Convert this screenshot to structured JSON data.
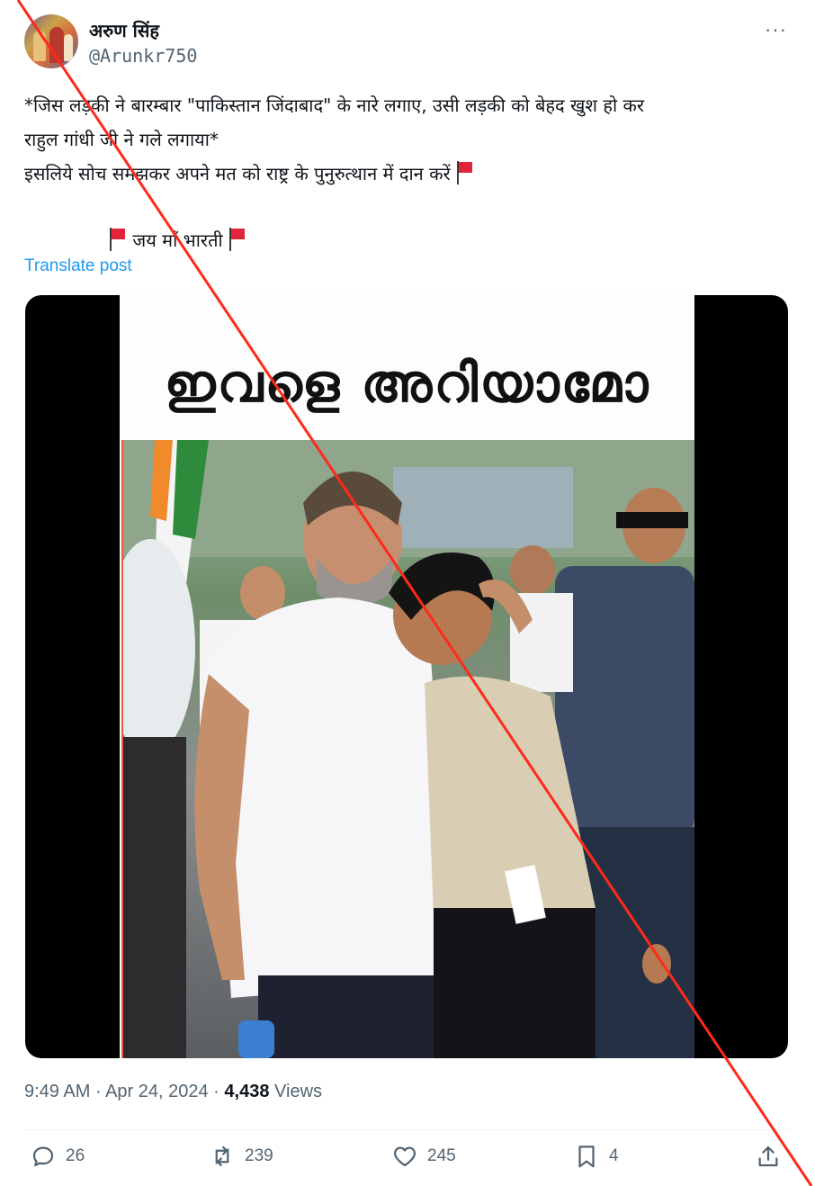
{
  "author": {
    "display_name": "अरुण सिंह",
    "handle": "@Arunkr750",
    "avatar_icon": "profile-photo"
  },
  "more_icon": "ellipsis-icon",
  "more_label": "···",
  "tweet": {
    "lines": [
      "*जिस लड़की ने बारम्बार \"पाकिस्तान जिंदाबाद\" के नारे लगाए, उसी लड़की को बेहद खुश हो कर",
      "राहुल गांधी जी ने गले लगाया*",
      "इसलिये सोच समझकर अपने मत को राष्ट्र के पुनुरुत्थान में दान करें",
      "जय माँ भारती"
    ],
    "flag_icon": "red-flag-emoji",
    "translate_label": "Translate post"
  },
  "media": {
    "title": "ഇവളെ അറിയാമോ",
    "description_icon": "photo"
  },
  "meta": {
    "time": "9:49 AM",
    "separator": "·",
    "date": "Apr 24, 2024",
    "separator2": "·",
    "views_count": "4,438",
    "views_label": "Views"
  },
  "actions": {
    "replies": "26",
    "reposts": "239",
    "likes": "245",
    "bookmarks": "4"
  },
  "colors": {
    "accent": "#1d9bf0",
    "muted": "#536471",
    "overlay_line": "#ff2a1a"
  }
}
